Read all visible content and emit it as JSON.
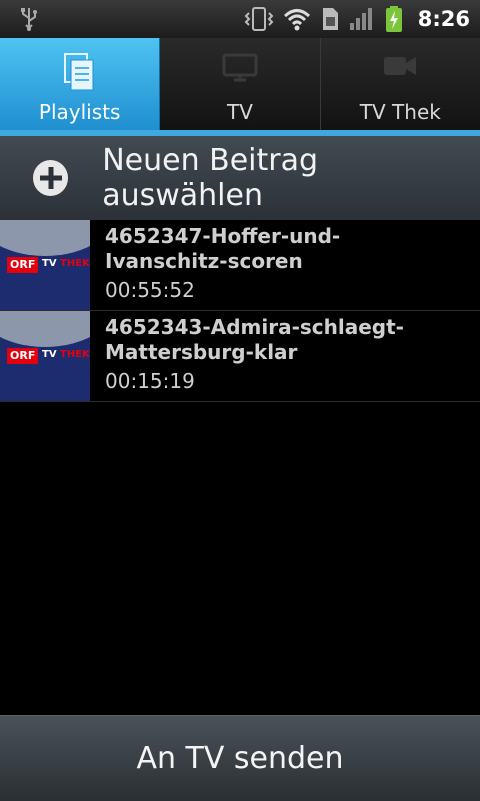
{
  "status_bar": {
    "time": "8:26",
    "icons": [
      "usb-icon",
      "vibrate-icon",
      "wifi-icon",
      "sim-icon",
      "signal-icon",
      "battery-charging-icon"
    ]
  },
  "tabs": [
    {
      "label": "Playlists",
      "icon": "playlist-icon",
      "active": true
    },
    {
      "label": "TV",
      "icon": "tv-icon",
      "active": false
    },
    {
      "label": "TV Thek",
      "icon": "video-camera-icon",
      "active": false
    }
  ],
  "add_row": {
    "label": "Neuen Beitrag auswählen",
    "icon": "plus-icon"
  },
  "items": [
    {
      "title": "4652347-Hoffer-und-Ivanschitz-scoren",
      "duration": "00:55:52",
      "thumb": {
        "orf": "ORF",
        "tv": "TV",
        "thek": "THEK"
      }
    },
    {
      "title": "4652343-Admira-schlaegt-Mattersburg-klar",
      "duration": "00:15:19",
      "thumb": {
        "orf": "ORF",
        "tv": "TV",
        "thek": "THEK"
      }
    }
  ],
  "send_button": {
    "label": "An TV senden"
  },
  "colors": {
    "accent": "#3ea8df",
    "orf_red": "#e3000f",
    "thumb_bg": "#1d2c6e"
  }
}
